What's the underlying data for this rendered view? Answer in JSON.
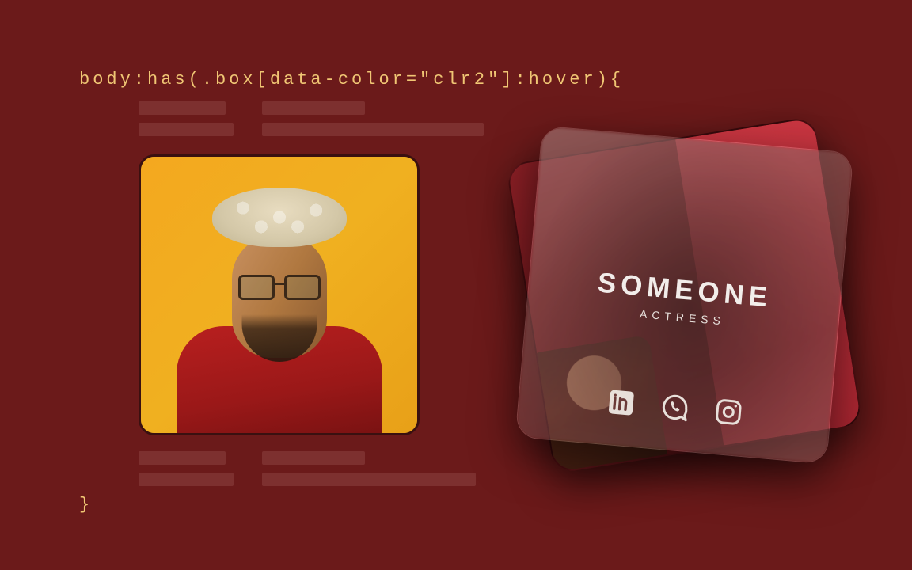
{
  "code": {
    "selector": "body:has(.box[data-color=\"clr2\"]:hover){",
    "close": "}"
  },
  "card": {
    "name": "SOMEONE",
    "role": "ACTRESS",
    "social_icons": [
      "linkedin-icon",
      "whatsapp-icon",
      "instagram-icon"
    ]
  }
}
